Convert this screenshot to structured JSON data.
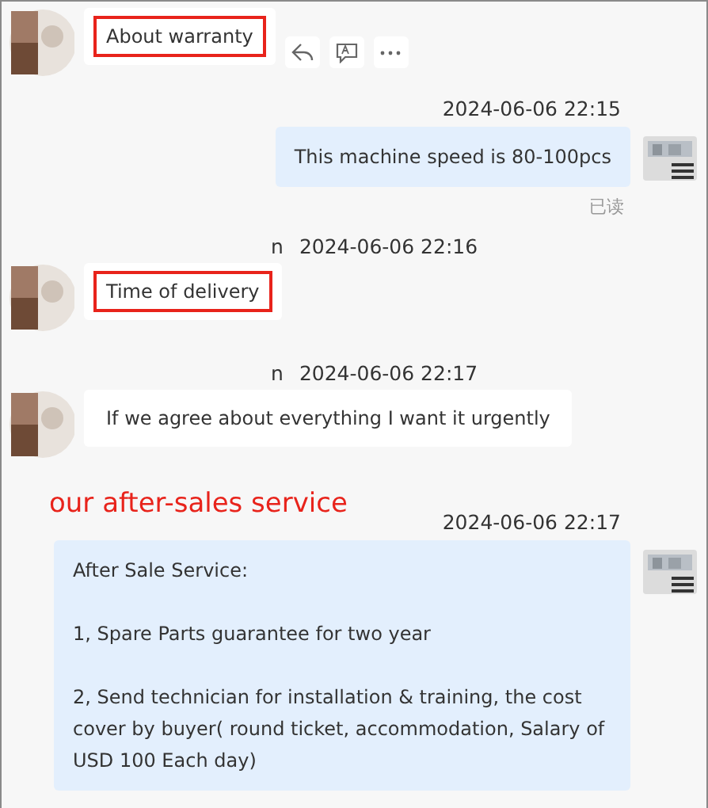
{
  "messages": [
    {
      "kind": "incoming",
      "highlighted": true,
      "actions": true,
      "paragraphs": [
        "About warranty"
      ]
    },
    {
      "kind": "outgoing",
      "time": "2024-06-06 22:15",
      "read_status": "已读",
      "paragraphs": [
        "This machine speed is 80-100pcs"
      ]
    },
    {
      "kind": "incoming",
      "sender": "n",
      "time": "2024-06-06 22:16",
      "highlighted": true,
      "actions": false,
      "paragraphs": [
        "Time of delivery"
      ]
    },
    {
      "kind": "incoming",
      "sender": "n",
      "time": "2024-06-06 22:17",
      "highlighted": false,
      "actions": false,
      "paragraphs": [
        "If we agree about everything I want it urgently"
      ]
    },
    {
      "kind": "outgoing",
      "annotation": "our after-sales service",
      "time": "2024-06-06 22:17",
      "paragraphs": [
        "After Sale Service:",
        "1, Spare Parts guarantee for two year",
        "2, Send technician for installation & training, the cost cover by buyer( round ticket, accommodation, Salary of USD 100 Each day)"
      ]
    }
  ]
}
